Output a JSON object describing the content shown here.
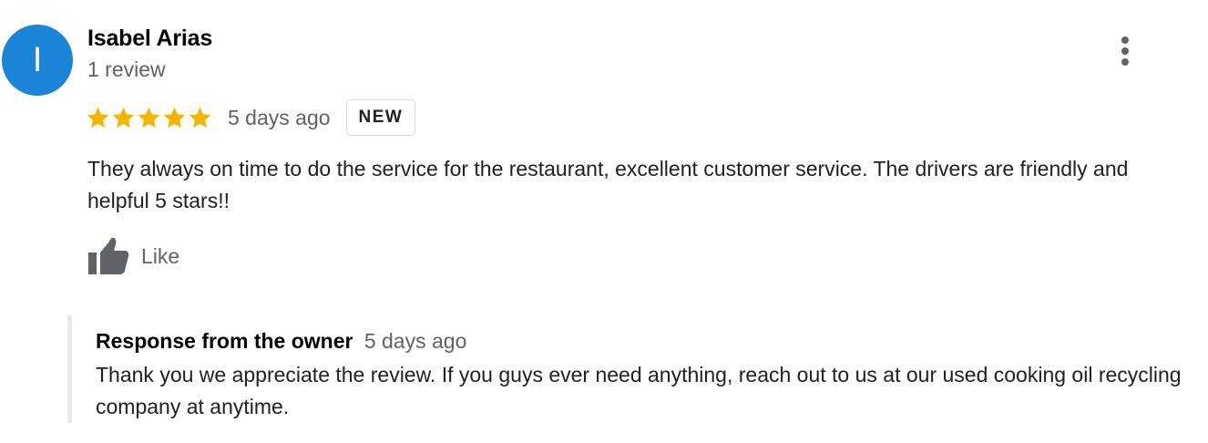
{
  "reviewer": {
    "initial": "I",
    "name": "Isabel Arias",
    "review_count": "1 review",
    "avatar_color": "#1a85d6"
  },
  "menu": {
    "icon": "more-vert-icon"
  },
  "review": {
    "rating": 5,
    "rating_max": 5,
    "star_color": "#f4b400",
    "date": "5 days ago",
    "badge": "NEW",
    "text": "They always on time to do the service for the restaurant, excellent customer service. The drivers are friendly and helpful 5 stars!!"
  },
  "like": {
    "label": "Like",
    "icon": "thumbs-up-icon"
  },
  "owner_response": {
    "title": "Response from the owner",
    "date": "5 days ago",
    "text": "Thank you we appreciate the review. If you guys ever need anything, reach out to us at our used cooking oil recycling company at anytime."
  }
}
